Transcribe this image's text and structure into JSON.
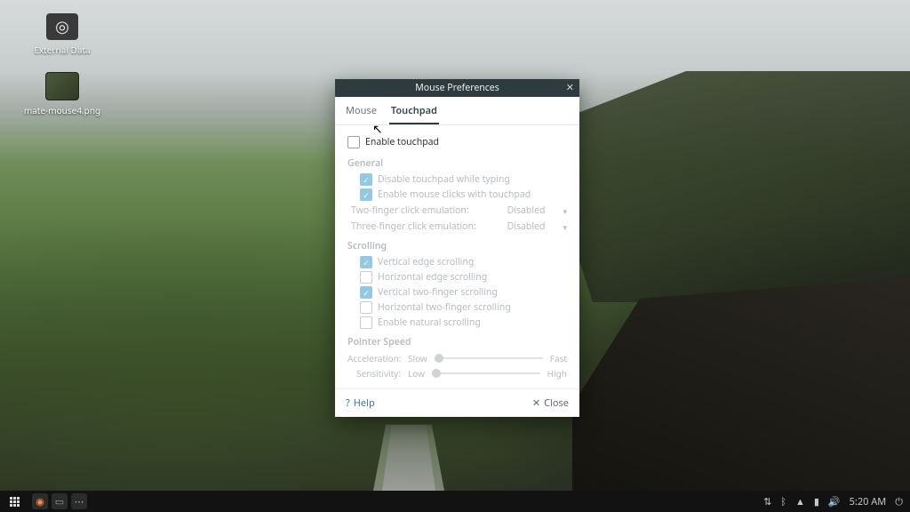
{
  "desktop": {
    "icons": [
      {
        "label": "External Data",
        "glyph": "◎"
      },
      {
        "label": "mate-mouse4.png",
        "glyph": ""
      }
    ]
  },
  "dialog": {
    "title": "Mouse Preferences",
    "tabs": {
      "mouse": "Mouse",
      "touchpad": "Touchpad",
      "active": "touchpad"
    },
    "enable_touchpad_label": "Enable touchpad",
    "enable_touchpad_checked": false,
    "sections": {
      "general": {
        "title": "General",
        "disable_while_typing": {
          "label": "Disable touchpad while typing",
          "checked": true
        },
        "mouse_clicks": {
          "label": "Enable mouse clicks with touchpad",
          "checked": true
        },
        "two_finger_label": "Two-finger click emulation:",
        "two_finger_value": "Disabled",
        "three_finger_label": "Three-finger click emulation:",
        "three_finger_value": "Disabled"
      },
      "scrolling": {
        "title": "Scrolling",
        "vert_edge": {
          "label": "Vertical edge scrolling",
          "checked": true
        },
        "horiz_edge": {
          "label": "Horizontal edge scrolling",
          "checked": false
        },
        "vert_twof": {
          "label": "Vertical two-finger scrolling",
          "checked": true
        },
        "horiz_twof": {
          "label": "Horizontal two-finger scrolling",
          "checked": false
        },
        "natural": {
          "label": "Enable natural scrolling",
          "checked": false
        }
      },
      "speed": {
        "title": "Pointer Speed",
        "accel_label": "Acceleration:",
        "accel_low": "Slow",
        "accel_high": "Fast",
        "sens_label": "Sensitivity:",
        "sens_low": "Low",
        "sens_high": "High"
      }
    },
    "footer": {
      "help": "Help",
      "close": "Close"
    }
  },
  "panel": {
    "clock": "5:20 AM"
  }
}
